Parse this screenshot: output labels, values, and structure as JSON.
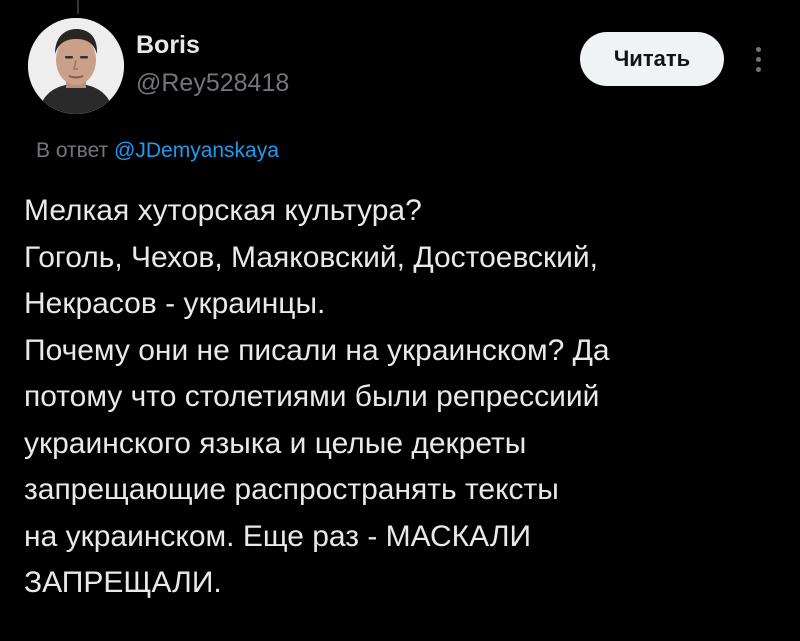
{
  "author": {
    "display_name": "Boris",
    "handle": "@Rey528418"
  },
  "actions": {
    "follow_label": "Читать",
    "more_icon": "more-vertical-icon"
  },
  "reply_context": {
    "prefix": "В ответ",
    "mention": "@JDemyanskaya"
  },
  "tweet": {
    "lines": [
      "Мелкая хуторская культура?",
      "Гоголь, Чехов, Маяковский, Достоевский,",
      "Некрасов - украинцы.",
      "Почему они не писали на украинском? Да",
      "потому что столетиями были репрессиий",
      "украинского языка и целые декреты",
      "запрещающие распространять тексты",
      "на украинском. Еще раз - МАСКАЛИ",
      "ЗАПРЕЩАЛИ."
    ]
  },
  "colors": {
    "background": "#000000",
    "text_primary": "#e7e9ea",
    "text_secondary": "#71767b",
    "link": "#1d9bf0",
    "button_bg": "#eff3f4",
    "button_text": "#0f1419"
  }
}
